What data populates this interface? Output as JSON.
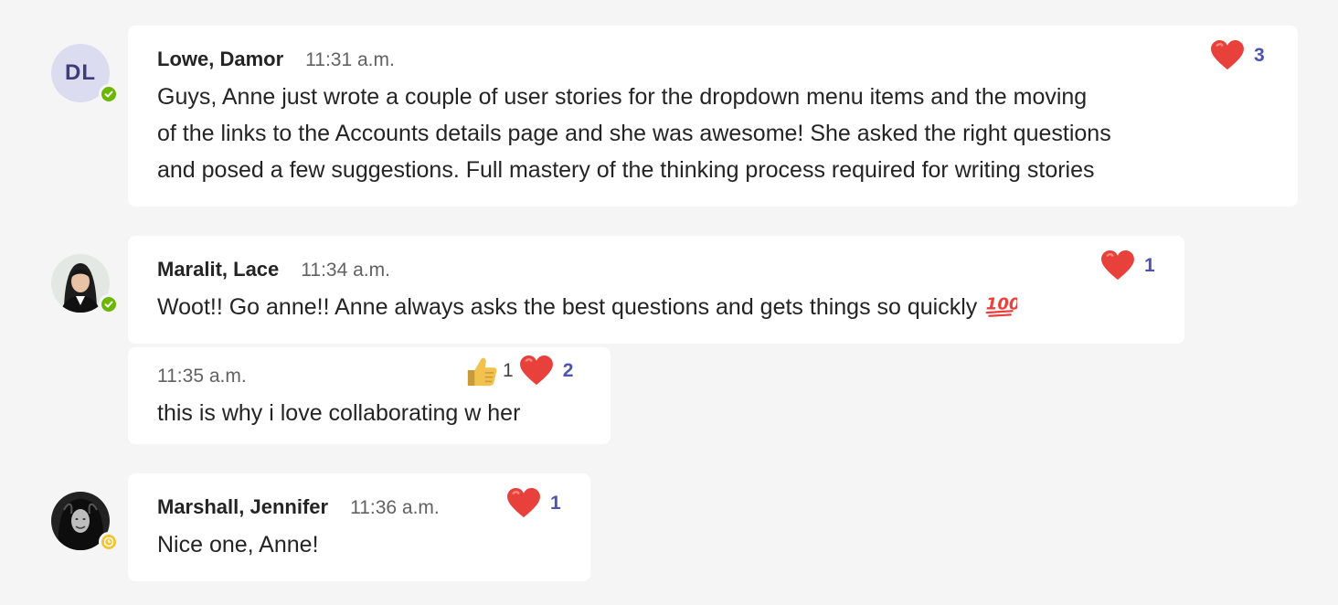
{
  "messages": [
    {
      "author": "Lowe, Damor",
      "initials": "DL",
      "time": "11:31 a.m.",
      "status": "available",
      "lines": [
        "Guys, Anne just wrote a couple of user stories for the dropdown menu items and the moving",
        "of the links to the Accounts details page and she was awesome! She asked the right questions",
        "and posed a few suggestions. Full mastery of the thinking process required for writing stories"
      ],
      "reactions": [
        {
          "icon": "heart-icon",
          "count": "3"
        }
      ]
    },
    {
      "author": "Maralit, Lace",
      "time": "11:34 a.m.",
      "status": "available",
      "text": "Woot!! Go anne!! Anne always asks the best questions and gets things so quickly",
      "emoji": "hundred-points-icon",
      "reactions": [
        {
          "icon": "heart-icon",
          "count": "1"
        }
      ]
    },
    {
      "time": "11:35 a.m.",
      "text": "this is why i love collaborating w her",
      "reactions": [
        {
          "icon": "thumbs-up-icon",
          "count": "1"
        },
        {
          "icon": "heart-icon",
          "count": "2"
        }
      ]
    },
    {
      "author": "Marshall, Jennifer",
      "time": "11:36 a.m.",
      "status": "away",
      "text": "Nice one, Anne!",
      "reactions": [
        {
          "icon": "heart-icon",
          "count": "1"
        }
      ]
    }
  ],
  "colors": {
    "background": "#f5f5f5",
    "bubble": "#ffffff",
    "reaction_count": "#4f52b2",
    "heart": "#e8413b",
    "available": "#6bb700",
    "away": "#f8c42d"
  }
}
